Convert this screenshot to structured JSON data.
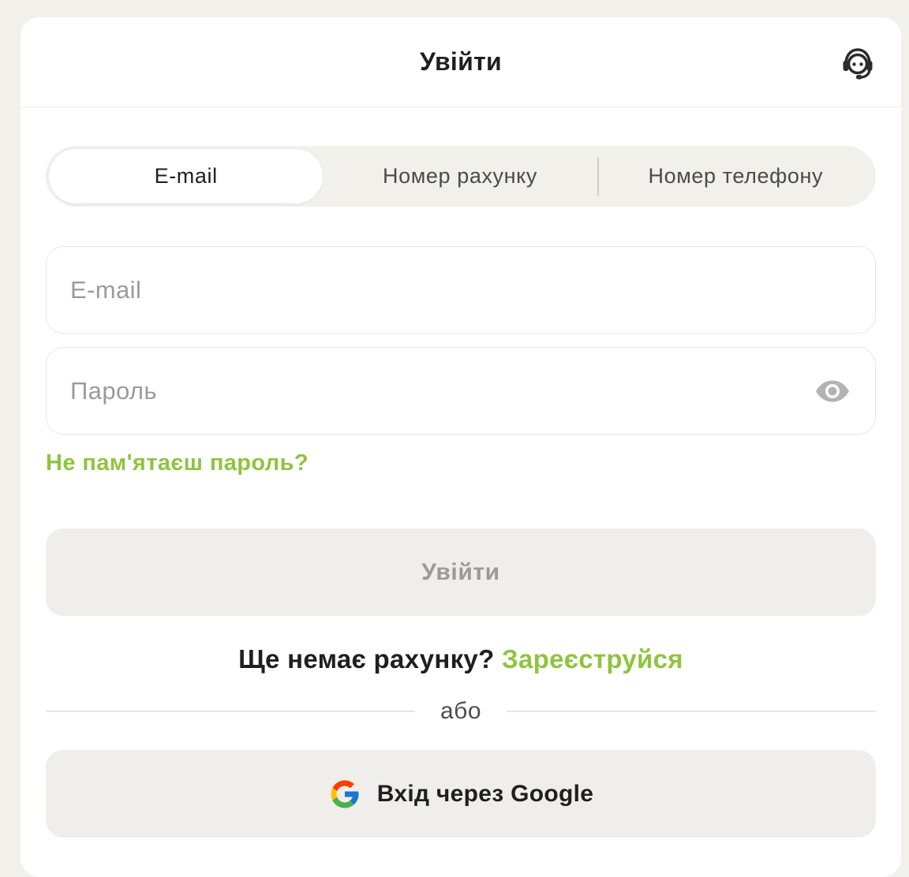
{
  "header": {
    "title": "Увійти",
    "support_icon": "headset-icon"
  },
  "tabs": [
    {
      "label": "E-mail",
      "active": true
    },
    {
      "label": "Номер рахунку",
      "active": false
    },
    {
      "label": "Номер телефону",
      "active": false
    }
  ],
  "form": {
    "email": {
      "placeholder": "E-mail",
      "value": ""
    },
    "password": {
      "placeholder": "Пароль",
      "value": "",
      "toggle_icon": "eye-icon"
    },
    "forgot_label": "Не пам'ятаєш пароль?",
    "submit_label": "Увійти"
  },
  "signup": {
    "prompt": "Ще немає рахунку?",
    "link_label": "Зареєструйся"
  },
  "divider": {
    "label": "або"
  },
  "google": {
    "label": "Вхід через Google",
    "icon": "google-icon"
  },
  "colors": {
    "accent": "#8fc43f",
    "background": "#f1f0eb",
    "card": "#ffffff",
    "disabled_button": "#efeeea"
  }
}
